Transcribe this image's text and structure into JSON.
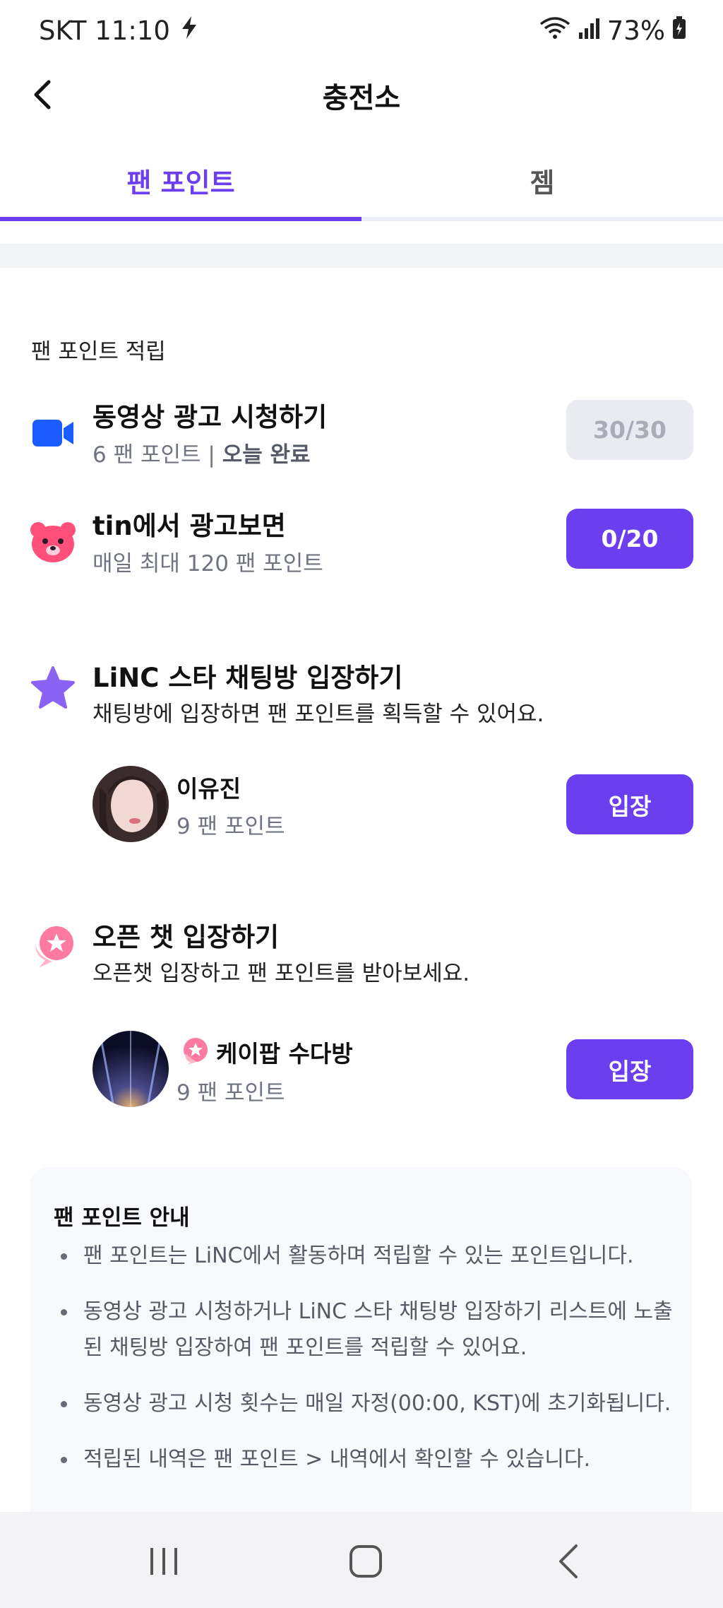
{
  "status_bar": {
    "carrier_time": "SKT 11:10",
    "battery": "73%",
    "icons": [
      "charging-bolt-icon",
      "wifi-icon",
      "signal-icon",
      "battery-icon"
    ]
  },
  "header": {
    "title": "충전소",
    "back_icon": "chevron-left-icon"
  },
  "tabs": [
    {
      "label": "팬 포인트",
      "active": true
    },
    {
      "label": "젬",
      "active": false
    }
  ],
  "colors": {
    "accent": "#6b3ff0",
    "disabled_bg": "#e9ebf0",
    "video_icon": "#1a5cff",
    "bear_icon": "#ff4f7a",
    "star_icon": "#8a63f5",
    "chat_icon": "#ff7aa0"
  },
  "earn_section": {
    "label": "팬 포인트 적립",
    "video_ad": {
      "icon": "video-camera-icon",
      "title": "동영상 광고 시청하기",
      "points": "6 팬 포인트",
      "separator": "|",
      "status": "오늘 완료",
      "button": "30/30"
    },
    "tin_ad": {
      "icon": "bear-icon",
      "title": "tin에서 광고보면",
      "subtitle": "매일 최대 120 팬 포인트",
      "button": "0/20"
    },
    "star_chat": {
      "icon": "star-icon",
      "title": "LiNC 스타 채팅방 입장하기",
      "description": "채팅방에 입장하면 팬 포인트를 획득할 수 있어요.",
      "room": {
        "name": "이유진",
        "points": "9 팬 포인트",
        "button": "입장"
      }
    },
    "open_chat": {
      "icon": "chat-bubble-star-icon",
      "title": "오픈 챗 입장하기",
      "description": "오픈챗 입장하고 팬 포인트를 받아보세요.",
      "room": {
        "name": "케이팝 수다방",
        "points": "9 팬 포인트",
        "button": "입장"
      }
    }
  },
  "info": {
    "title": "팬 포인트 안내",
    "items": [
      "팬 포인트는 LiNC에서 활동하며 적립할 수 있는 포인트입니다.",
      "동영상 광고 시청하거나 LiNC 스타 채팅방 입장하기 리스트에 노출된 채팅방 입장하여 팬 포인트를 적립할 수 있어요.",
      "동영상 광고 시청 횟수는 매일 자정(00:00, KST)에 초기화됩니다.",
      "적립된 내역은 팬 포인트 > 내역에서 확인할 수 있습니다."
    ]
  },
  "nav_bar": {
    "icons": [
      "recent-apps-icon",
      "home-icon",
      "back-icon"
    ]
  }
}
